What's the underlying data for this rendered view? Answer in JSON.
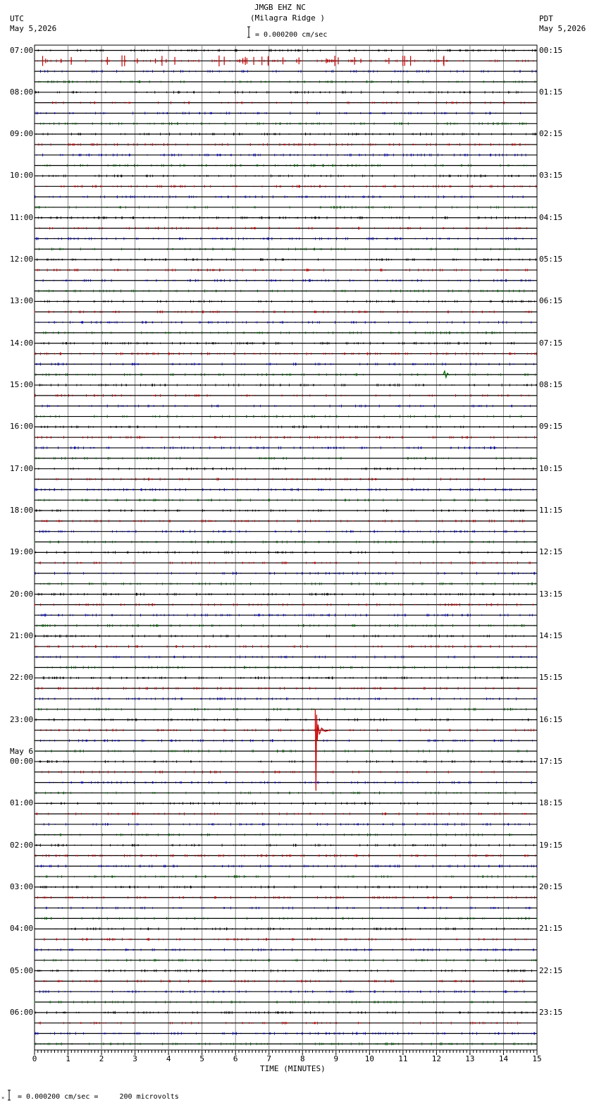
{
  "header": {
    "station": "JMGB EHZ NC",
    "site": "(Milagra Ridge )",
    "scale_text": "= 0.000200 cm/sec",
    "left_zone": "UTC",
    "left_date": "May 5,2026",
    "right_zone": "PDT",
    "right_date": "May 5,2026"
  },
  "footer": {
    "scale_text": "= 0.000200 cm/sec =     200 microvolts"
  },
  "chart_data": {
    "type": "seismogram",
    "xlabel": "TIME (MINUTES)",
    "x_ticks": [
      "0",
      "1",
      "2",
      "3",
      "4",
      "5",
      "6",
      "7",
      "8",
      "9",
      "10",
      "11",
      "12",
      "13",
      "14",
      "15"
    ],
    "xlim": [
      0,
      15
    ],
    "trace_colors": [
      "#000000",
      "#cc0000",
      "#0000cc",
      "#006600"
    ],
    "left_hour_labels": [
      "07:00",
      "08:00",
      "09:00",
      "10:00",
      "11:00",
      "12:00",
      "13:00",
      "14:00",
      "15:00",
      "16:00",
      "17:00",
      "18:00",
      "19:00",
      "20:00",
      "21:00",
      "22:00",
      "23:00",
      "00:00",
      "01:00",
      "02:00",
      "03:00",
      "04:00",
      "05:00",
      "06:00"
    ],
    "date_change_label": "May 6",
    "right_hour_labels": [
      "00:15",
      "01:15",
      "02:15",
      "03:15",
      "04:15",
      "05:15",
      "06:15",
      "07:15",
      "08:15",
      "09:15",
      "10:15",
      "11:15",
      "12:15",
      "13:15",
      "14:15",
      "15:15",
      "16:15",
      "17:15",
      "18:15",
      "19:15",
      "20:15",
      "21:15",
      "22:15",
      "23:15"
    ],
    "events": [
      {
        "row": 65,
        "minute": 8.38,
        "amplitude": "large",
        "color": "#cc0000",
        "description_time": "23:15 UTC"
      },
      {
        "row": 1,
        "minute": 0.0,
        "amplitude": "moderate",
        "color": "#cc0000"
      },
      {
        "row": 31,
        "minute": 12.2,
        "amplitude": "small",
        "color": "#006600"
      }
    ]
  }
}
